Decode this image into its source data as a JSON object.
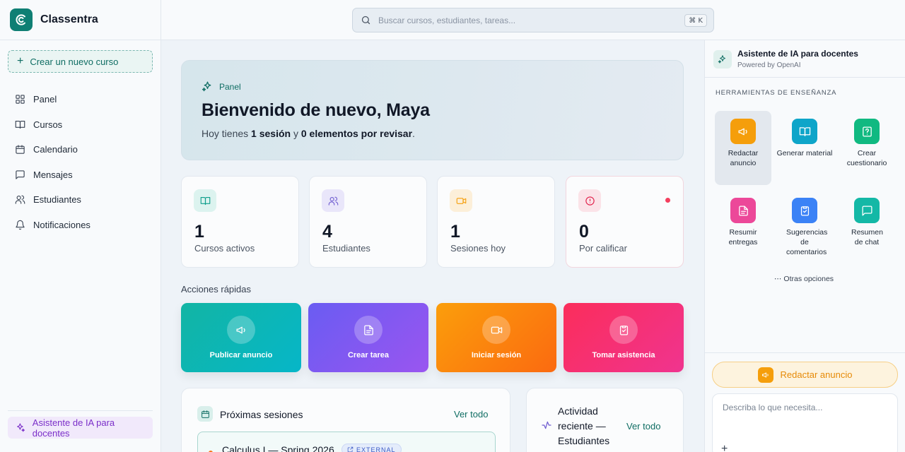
{
  "brand": {
    "name": "Classentra"
  },
  "sidebar": {
    "new_course": "Crear un nuevo curso",
    "items": [
      {
        "label": "Panel",
        "icon": "grid-icon"
      },
      {
        "label": "Cursos",
        "icon": "book-icon"
      },
      {
        "label": "Calendario",
        "icon": "calendar-icon"
      },
      {
        "label": "Mensajes",
        "icon": "message-icon"
      },
      {
        "label": "Estudiantes",
        "icon": "users-icon"
      },
      {
        "label": "Notificaciones",
        "icon": "bell-icon"
      }
    ],
    "ai_assistant": "Asistente de IA para docentes"
  },
  "search": {
    "placeholder": "Buscar cursos, estudiantes, tareas...",
    "shortcut": "⌘ K"
  },
  "hero": {
    "tag": "Panel",
    "title": "Bienvenido de nuevo, Maya",
    "sub_prefix": "Hoy tienes ",
    "sessions": "1 sesión",
    "sub_mid": " y ",
    "pending": "0 elementos por revisar",
    "sub_suffix": "."
  },
  "stats": [
    {
      "value": "1",
      "label": "Cursos activos",
      "icon": "book-icon",
      "color": "#0f9f8c"
    },
    {
      "value": "4",
      "label": "Estudiantes",
      "icon": "users-icon",
      "color": "#6d5bd0"
    },
    {
      "value": "1",
      "label": "Sesiones hoy",
      "icon": "video-icon",
      "color": "#f59e0b"
    },
    {
      "value": "0",
      "label": "Por calificar",
      "icon": "alert-icon",
      "color": "#e11d48"
    }
  ],
  "quick_actions": {
    "title": "Acciones rápidas",
    "items": [
      {
        "label": "Publicar anuncio",
        "icon": "megaphone-icon"
      },
      {
        "label": "Crear tarea",
        "icon": "file-icon"
      },
      {
        "label": "Iniciar sesión",
        "icon": "video-icon"
      },
      {
        "label": "Tomar asistencia",
        "icon": "clipboard-check-icon"
      }
    ]
  },
  "sessions_card": {
    "title": "Próximas sesiones",
    "see_all": "Ver todo",
    "items": [
      {
        "title": "Calculus I — Spring 2026",
        "badge": "EXTERNAL"
      }
    ]
  },
  "activity_card": {
    "title": "Actividad reciente — Estudiantes",
    "see_all": "Ver todo"
  },
  "right_panel": {
    "title": "Asistente de IA para docentes",
    "subtitle": "Powered by OpenAI",
    "tools_title": "HERRAMIENTAS DE ENSEÑANZA",
    "tools": [
      {
        "label": "Redactar anuncio",
        "icon": "megaphone-icon",
        "color": "#f59e0b"
      },
      {
        "label": "Generar material",
        "icon": "book-icon",
        "color": "#0ea5c9"
      },
      {
        "label": "Crear cuestionario",
        "icon": "quiz-icon",
        "color": "#10b981"
      },
      {
        "label": "Resumir entregas",
        "icon": "file-icon",
        "color": "#ec4899"
      },
      {
        "label": "Sugerencias de comentarios",
        "icon": "clipboard-check-icon",
        "color": "#3b82f6"
      },
      {
        "label": "Resumen de chat",
        "icon": "message-icon",
        "color": "#14b8a6"
      }
    ],
    "more": "⋯ Otras opciones",
    "compose_button": "Redactar anuncio",
    "prompt_placeholder": "Describa lo que necesita...",
    "attach": "+"
  }
}
